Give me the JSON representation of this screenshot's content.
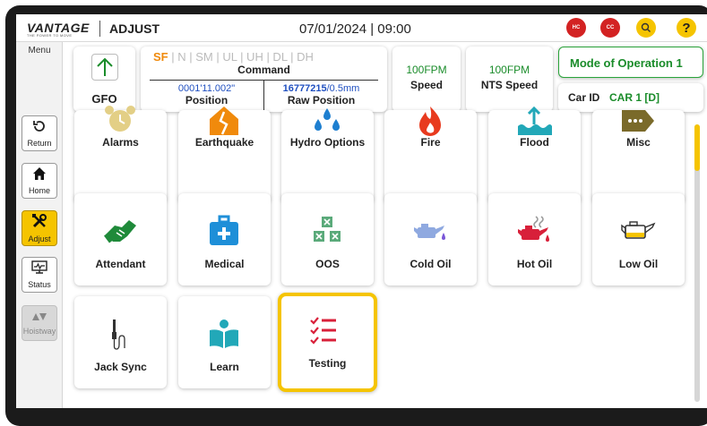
{
  "header": {
    "brand": "VANTAGE",
    "tagline": "THE POWER TO MOVE",
    "breadcrumb": "ADJUST",
    "datetime": "07/01/2024 | 09:00",
    "hc_label": "HC",
    "cc_label": "CC",
    "help_label": "?"
  },
  "menu": {
    "title": "Menu",
    "items": [
      {
        "label": "Return",
        "icon": "return-icon"
      },
      {
        "label": "Home",
        "icon": "home-icon"
      },
      {
        "label": "Adjust",
        "icon": "tools-icon",
        "active": true
      },
      {
        "label": "Status",
        "icon": "monitor-icon"
      },
      {
        "label": "Hoistway",
        "icon": "hoistway-icon",
        "disabled": true
      }
    ]
  },
  "info": {
    "gfo_label": "GFO",
    "command": {
      "active_mode": "SF",
      "other_modes": " | N | SM | UL | UH | DL | DH",
      "label": "Command"
    },
    "position": {
      "value": "0001'11.002\"",
      "label": "Position"
    },
    "raw_position": {
      "value_bold": "16777215",
      "value_rest": "/0.5mm",
      "label": "Raw Position"
    },
    "speed": {
      "value": "100FPM",
      "label": "Speed"
    },
    "nts_speed": {
      "value": "100FPM",
      "label": "NTS Speed"
    },
    "mode_of_operation": "Mode of Operation 1",
    "car_id": {
      "label": "Car ID",
      "value": "CAR 1 [D]"
    }
  },
  "tiles": [
    {
      "label": "Alarms",
      "icon": "alarm-clock-icon"
    },
    {
      "label": "Earthquake",
      "icon": "earthquake-icon"
    },
    {
      "label": "Hydro Options",
      "icon": "droplets-icon"
    },
    {
      "label": "Fire",
      "icon": "fire-icon"
    },
    {
      "label": "Flood",
      "icon": "flood-icon"
    },
    {
      "label": "Misc",
      "icon": "tag-icon"
    },
    {
      "label": "Attendant",
      "icon": "handshake-icon"
    },
    {
      "label": "Medical",
      "icon": "medical-kit-icon"
    },
    {
      "label": "OOS",
      "icon": "oos-boxes-icon"
    },
    {
      "label": "Cold Oil",
      "icon": "oil-can-icon"
    },
    {
      "label": "Hot Oil",
      "icon": "hot-oil-can-icon"
    },
    {
      "label": "Low Oil",
      "icon": "low-oil-can-icon"
    },
    {
      "label": "Jack Sync",
      "icon": "jack-icon"
    },
    {
      "label": "Learn",
      "icon": "reader-icon"
    },
    {
      "label": "Testing",
      "icon": "checklist-icon",
      "selected": true
    }
  ],
  "colors": {
    "accent": "#f5c400",
    "alert": "#d32222",
    "ok": "#1a8c2a",
    "value_blue": "#2050c0"
  }
}
